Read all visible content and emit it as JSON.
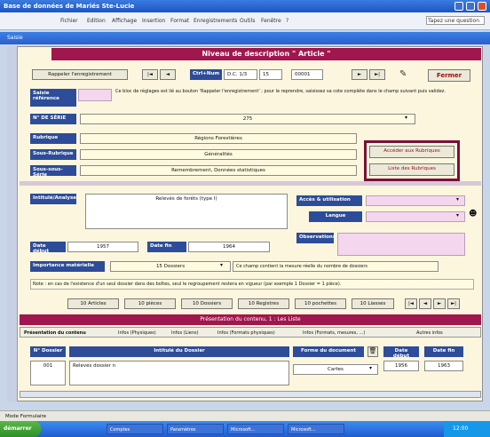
{
  "window": {
    "title": "Base de données de Mariés Ste-Lucie"
  },
  "menu": {
    "items": [
      "Fichier",
      "Edition",
      "Affichage",
      "Insertion",
      "Format",
      "Enregistrements",
      "Outils",
      "Fenêtre",
      "?"
    ],
    "search_placeholder": "Tapez une question"
  },
  "form": {
    "inner_title": "Saisie",
    "header": "Niveau de description \" Article \"",
    "btn_goto": "Rappeler l'enregistrement",
    "btn_first": "|◄",
    "btn_prev": "◄",
    "btn_num_label": "Ctrl+Num",
    "cote_a": "D.C. 1/3",
    "cote_b": "15",
    "cote_c": "00001",
    "btn_next": "►",
    "btn_last": "►|",
    "btn_fermer": "Fermer",
    "note_label": "Saisie référence",
    "note_text": "Ce bloc de réglages est lié au bouton 'Rappeler l'enregistrement' ; pour le reprendre, saisissez sa cote complète dans le champ suivant puis validez.",
    "id_label": "N° DE SÉRIE",
    "id_value": "275",
    "rubrique_label": "Rubrique",
    "rubrique_value": "Régions Forestières",
    "sous_label": "Sous-Rubrique",
    "sous_value": "Généralités",
    "sous2_label": "Sous-sous-Série",
    "sous2_value": "Remembrement, Données statistiques",
    "btn_ajouter": "Accéder aux Rubriques",
    "btn_liste": "Liste des Rubriques",
    "intitule_label": "Intitulé/Analyse",
    "intitule_value": "Relevés de forêts (type I)",
    "acces_label": "Accès & utilisation",
    "langue_label": "Langue",
    "date_debut_label": "Date début",
    "date_debut_value": "1957",
    "date_fin_label": "Date fin",
    "date_fin_value": "1964",
    "observ_label": "Observations",
    "import_label": "Importance matérielle",
    "import_value": "15 Dossiers",
    "import_note": "Ce champ contient la mesure réelle du nombre de dossiers",
    "note2": "Note : en cas de l'existence d'un seul dossier dans des boîtes, seul le regroupement restera en vigueur (par exemple 1 Dossier = 1 pièce).",
    "quick_buttons": [
      "10 Articles",
      "10 pièces",
      "10 Dossiers",
      "10 Registres",
      "10 pochettes",
      "10 Liasses"
    ],
    "sub_header": "Présentation du contenu, 1 : Les Liste",
    "tabs": [
      "Présentation du contenu",
      "Infos (Physiques)",
      "Infos (Liens)",
      "Infos (Formats physiques)",
      "Infos (Formats, mesures, ...)",
      "Autres infos"
    ],
    "col_headers": [
      "N° Dossier",
      "Intitulé du Dossier",
      "Forme du document",
      "Date début",
      "Date fin"
    ],
    "row": {
      "num": "001",
      "titre": "Relevés dossier n",
      "forme": "Cartes",
      "debut": "1956",
      "fin": "1963"
    }
  },
  "status": "Mode Formulaire",
  "taskbar": {
    "start": "démarrer",
    "items": [
      "Comptes",
      "Paramètres",
      "Microsoft...",
      "Microsoft..."
    ],
    "clock": "12:00"
  }
}
